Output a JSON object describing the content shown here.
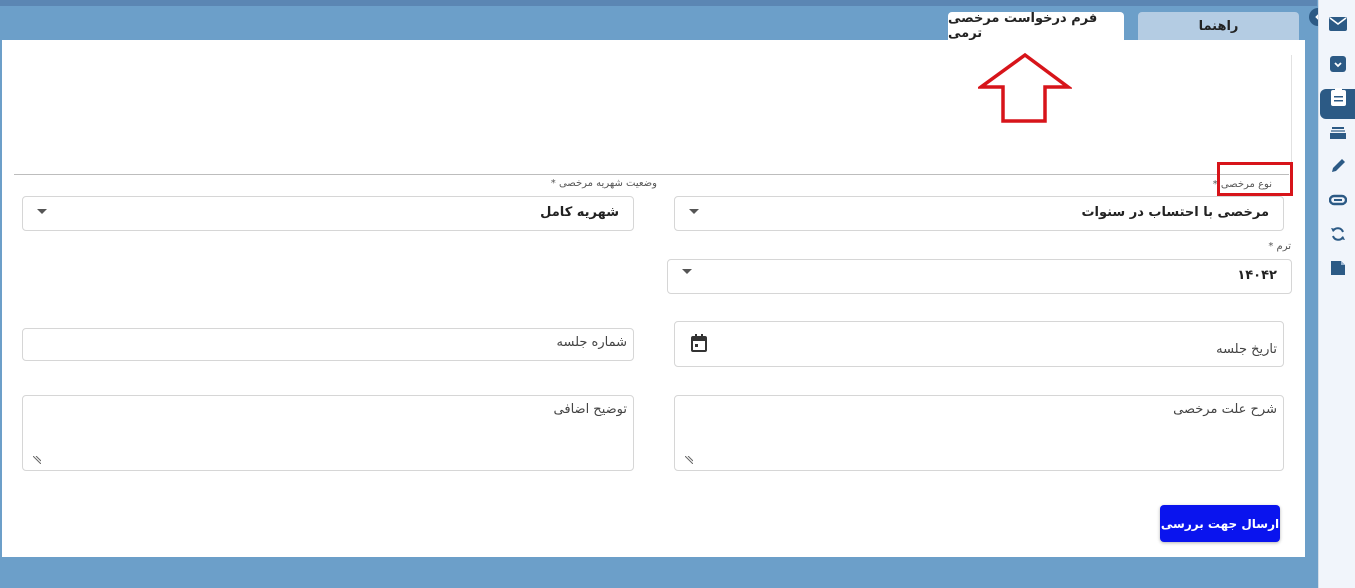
{
  "tabs": {
    "help": "راهنما",
    "leave_form": "فرم درخواست مرخصی ترمی"
  },
  "fields": {
    "leave_type": {
      "label": "نوع مرخصی",
      "value": "مرخصی با احتساب در سنوات"
    },
    "tuition_status": {
      "label": "وضعیت شهریه مرخصی",
      "value": "شهریه کامل"
    },
    "term": {
      "label": "ترم",
      "value": "۱۴۰۴۲"
    },
    "session_date": {
      "placeholder": "تاریخ جلسه"
    },
    "session_number": {
      "placeholder": "شماره جلسه"
    },
    "leave_reason": {
      "placeholder": "شرح علت مرخصی"
    },
    "extra_notes": {
      "placeholder": "توضیح اضافی"
    }
  },
  "required_mark": "*",
  "submit_label": "ارسال جهت بررسی",
  "sidebar_icons": [
    "mail-icon",
    "archive-icon",
    "clipboard-icon",
    "tray-icon",
    "pencil-icon",
    "link-icon",
    "sync-icon",
    "note-icon"
  ],
  "colors": {
    "accent": "#2c5a85",
    "button": "#0a14ee",
    "annotation": "#d7141a",
    "background": "#6c9fc9"
  }
}
